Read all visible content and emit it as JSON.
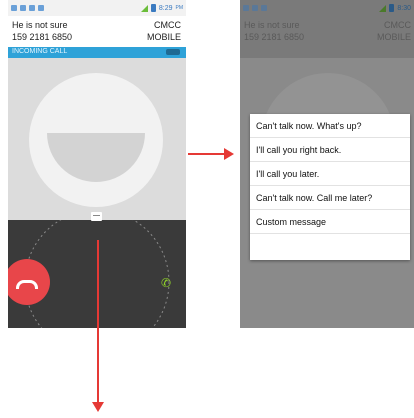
{
  "left_screen": {
    "status_time": "8:29",
    "status_ampm": "PM",
    "caller_name": "He is not sure",
    "caller_number": "159 2181 6850",
    "operator": "CMCC",
    "line_type": "MOBILE",
    "incoming_label": "INCOMING CALL"
  },
  "right_screen": {
    "status_time": "8:30",
    "caller_name": "He is not sure",
    "caller_number": "159 2181 6850",
    "operator": "CMCC",
    "line_type": "MOBILE",
    "quick_replies": [
      "Can't talk now. What's up?",
      "I'll call you right back.",
      "I'll call you later.",
      "Can't talk now. Call me later?",
      "Custom message"
    ]
  },
  "colors": {
    "accent_blue": "#2ea2d8",
    "decline_red": "#e8464a",
    "answer_green": "#8fd12a",
    "arrow_red": "#e53935"
  },
  "icons": {
    "decline": "end-call-icon",
    "answer": "phone-icon",
    "message": "message-icon"
  }
}
